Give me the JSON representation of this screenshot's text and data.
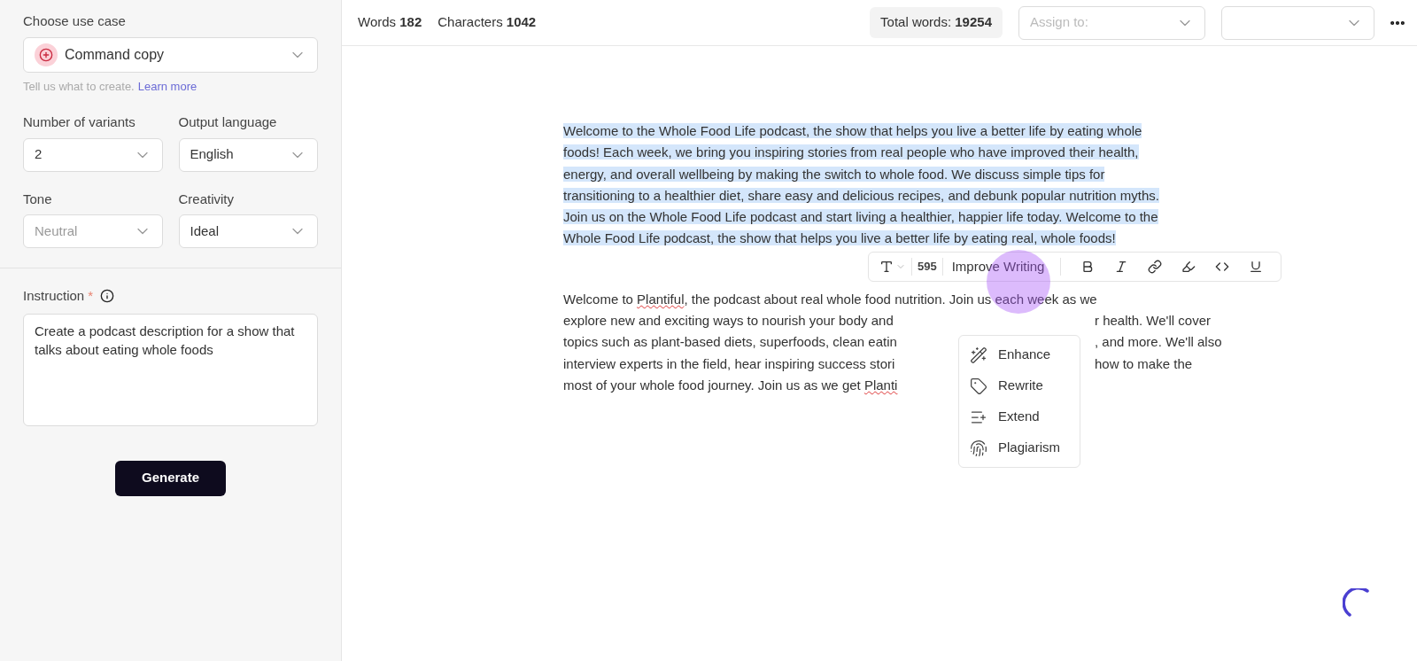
{
  "sidebar": {
    "use_case": {
      "label": "Choose use case",
      "value": "Command copy",
      "hint": "Tell us what to create.",
      "link": "Learn more"
    },
    "fields": [
      {
        "label": "Number of variants",
        "value": "2",
        "placeholder": false
      },
      {
        "label": "Output language",
        "value": "English",
        "placeholder": false
      },
      {
        "label": "Tone",
        "value": "Neutral",
        "placeholder": true
      },
      {
        "label": "Creativity",
        "value": "Ideal",
        "placeholder": false
      }
    ],
    "instruction": {
      "label": "Instruction",
      "required": "*",
      "value": "Create a podcast description for a show that talks about eating whole foods"
    },
    "generate": "Generate"
  },
  "topbar": {
    "words_label": "Words",
    "words": "182",
    "chars_label": "Characters",
    "chars": "1042",
    "total_label": "Total words:",
    "total": "19254",
    "assign": {
      "placeholder": "Assign to:"
    }
  },
  "editor": {
    "selected_paragraph": "Welcome to the Whole Food Life podcast, the show that helps you live a better life by eating whole foods! Each week, we bring you inspiring stories from real people who have improved their health, energy, and overall wellbeing by making the switch to whole food. We discuss simple tips for transitioning to a healthier diet, share easy and delicious recipes, and debunk popular nutrition myths. Join us on the Whole Food Life podcast and start living a healthier, happier life today. Welcome to the Whole Food Life podcast, the show that helps you live a better life by eating real, whole foods!",
    "lines": [
      {
        "left": [
          {
            "text": "Welcome to ",
            "misspelled": false
          },
          {
            "text": "Plantiful",
            "misspelled": true
          },
          {
            "text": ", the podcast about real whole food nutrition. Join us each week as we",
            "misspelled": false
          }
        ]
      },
      {
        "left": [
          {
            "text": "explore new and exciting ways to nourish your body and",
            "misspelled": false
          }
        ],
        "right": "r health. We'll cover"
      },
      {
        "left": [
          {
            "text": "topics such as plant-based diets, superfoods, clean eatin",
            "misspelled": false
          }
        ],
        "right": ", and more. We'll also"
      },
      {
        "left": [
          {
            "text": "interview experts in the field, hear inspiring success stori",
            "misspelled": false
          }
        ],
        "right": "how to make the"
      },
      {
        "left": [
          {
            "text": "most of your whole food journey. Join us as we get ",
            "misspelled": false
          },
          {
            "text": "Planti",
            "misspelled": true
          }
        ]
      }
    ],
    "toolbar": {
      "count": "595",
      "action": "Improve Writing"
    },
    "menu": [
      "Enhance",
      "Rewrite",
      "Extend",
      "Plagiarism"
    ]
  }
}
